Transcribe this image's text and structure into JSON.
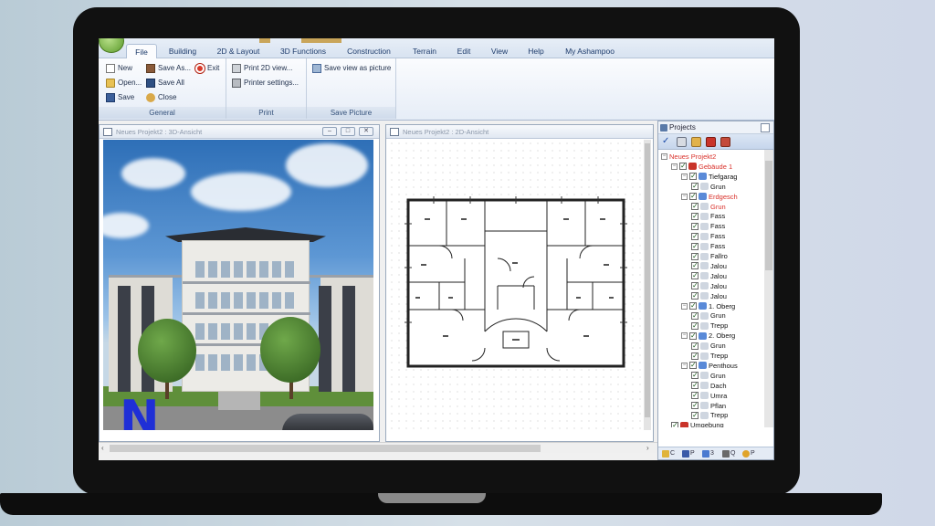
{
  "ribbon": {
    "tabs": [
      {
        "label": "File",
        "active": true
      },
      {
        "label": "Building"
      },
      {
        "label": "2D & Layout"
      },
      {
        "label": "3D Functions"
      },
      {
        "label": "Construction"
      },
      {
        "label": "Terrain"
      },
      {
        "label": "Edit"
      },
      {
        "label": "View"
      },
      {
        "label": "Help"
      },
      {
        "label": "My Ashampoo"
      }
    ],
    "groups": {
      "general": {
        "label": "General",
        "new": "New",
        "open": "Open...",
        "save": "Save",
        "save_as": "Save As...",
        "save_all": "Save All",
        "close": "Close",
        "exit": "Exit"
      },
      "print": {
        "label": "Print",
        "print_2d": "Print 2D view...",
        "printer_settings": "Printer settings..."
      },
      "save_picture": {
        "label": "Save Picture",
        "save_view": "Save view as picture"
      }
    }
  },
  "viewports": {
    "view3d": {
      "title": "Neues Projekt2 : 3D-Ansicht"
    },
    "view2d": {
      "title": "Neues Projekt2 : 2D-Ansicht"
    }
  },
  "projects": {
    "title": "Projects",
    "tree": [
      {
        "label": "Neues Projekt2",
        "level": 0,
        "red": true
      },
      {
        "label": "Gebäude 1",
        "level": 1,
        "red": true
      },
      {
        "label": "Tiefgarag",
        "level": 2
      },
      {
        "label": "Grun",
        "level": 3
      },
      {
        "label": "Erdgesch",
        "level": 2,
        "red": true
      },
      {
        "label": "Grun",
        "level": 3,
        "red": true
      },
      {
        "label": "Fass",
        "level": 3
      },
      {
        "label": "Fass",
        "level": 3
      },
      {
        "label": "Fass",
        "level": 3
      },
      {
        "label": "Fass",
        "level": 3
      },
      {
        "label": "Fallro",
        "level": 3
      },
      {
        "label": "Jalou",
        "level": 3
      },
      {
        "label": "Jalou",
        "level": 3
      },
      {
        "label": "Jalou",
        "level": 3
      },
      {
        "label": "Jalou",
        "level": 3
      },
      {
        "label": "1. Oberg",
        "level": 2
      },
      {
        "label": "Grun",
        "level": 3
      },
      {
        "label": "Trepp",
        "level": 3
      },
      {
        "label": "2. Oberg",
        "level": 2
      },
      {
        "label": "Grun",
        "level": 3
      },
      {
        "label": "Trepp",
        "level": 3
      },
      {
        "label": "Penthous",
        "level": 2
      },
      {
        "label": "Grun",
        "level": 3
      },
      {
        "label": "Dach",
        "level": 3
      },
      {
        "label": "Umra",
        "level": 3
      },
      {
        "label": "Pflan",
        "level": 3
      },
      {
        "label": "Trepp",
        "level": 3
      },
      {
        "label": "Umgebung",
        "level": 1
      }
    ],
    "footer_tabs": [
      "C",
      "P",
      "3",
      "Q",
      "P"
    ]
  }
}
